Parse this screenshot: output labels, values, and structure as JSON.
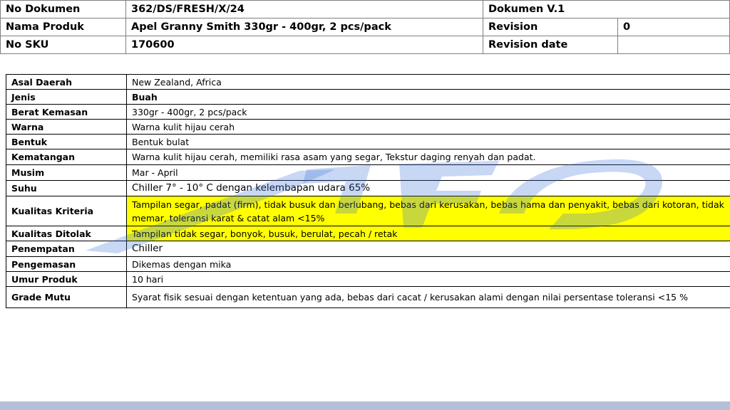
{
  "header": {
    "rows": [
      {
        "label": "No Dokumen",
        "value": "362/DS/FRESH/X/24",
        "label2": "Dokumen V.1",
        "value2": ""
      },
      {
        "label": "Nama Produk",
        "value": "Apel Granny Smith 330gr - 400gr, 2 pcs/pack",
        "label2": "Revision",
        "value2": "0"
      },
      {
        "label": "No SKU",
        "value": "170600",
        "label2": "Revision date",
        "value2": ""
      }
    ]
  },
  "spec": {
    "rows": [
      {
        "label": "Asal Daerah",
        "value": "New Zealand, Africa"
      },
      {
        "label": "Jenis",
        "value": "Buah"
      },
      {
        "label": "Berat Kemasan",
        "value": "330gr - 400gr, 2 pcs/pack"
      },
      {
        "label": "Warna",
        "value": "Warna kulit hijau cerah"
      },
      {
        "label": "Bentuk",
        "value": "Bentuk bulat"
      },
      {
        "label": "Kematangan",
        "value": "Warna kulit hijau cerah, memiliki rasa asam yang segar, Tekstur daging renyah dan padat."
      },
      {
        "label": "Musim",
        "value": "Mar - April"
      },
      {
        "label": "Suhu",
        "value": "Chiller 7° - 10° C dengan kelembapan udara 65%"
      },
      {
        "label": "Kualitas Kriteria",
        "value": "Tampilan segar, padat (firm), tidak busuk dan berlubang, bebas dari kerusakan, bebas hama dan penyakit, bebas dari kotoran, tidak memar, toleransi karat & catat alam <15%"
      },
      {
        "label": "Kualitas Ditolak",
        "value": "Tampilan tidak segar, bonyok, busuk, berulat, pecah / retak"
      },
      {
        "label": "Penempatan",
        "value": "Chiller"
      },
      {
        "label": "Pengemasan",
        "value": "Dikemas dengan mika"
      },
      {
        "label": "Umur Produk",
        "value": "10 hari"
      },
      {
        "label": "Grade Mutu",
        "value": "Syarat fisik sesuai dengan ketentuan yang ada, bebas dari cacat / kerusakan alami dengan  nilai persentase toleransi <15 %"
      }
    ]
  },
  "colors": {
    "highlight": "#ffff00",
    "watermark": "#3a6fd8",
    "footer_bar": "#b4c0d8"
  }
}
